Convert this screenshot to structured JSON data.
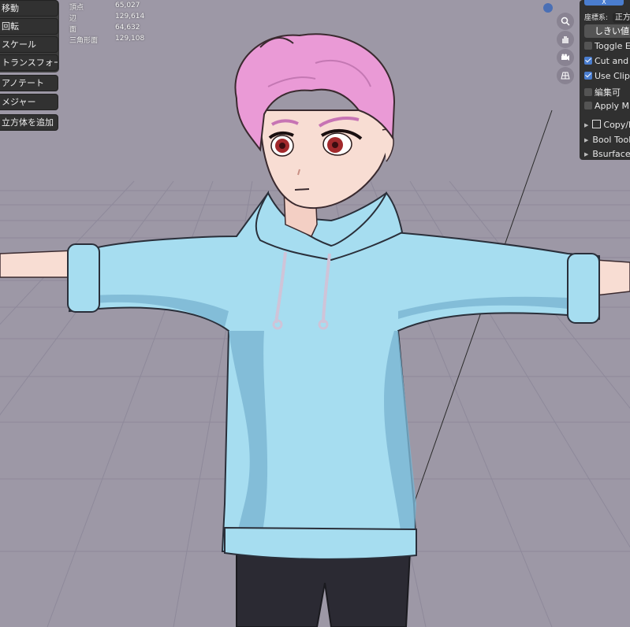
{
  "toolbar": {
    "move": "移動",
    "rotate": "回転",
    "scale": "スケール",
    "transform": "トランスフォーム",
    "annotate": "アノテート",
    "measure": "メジャー",
    "add_cube": "立方体を追加"
  },
  "stats": {
    "vertices_label": "頂点",
    "vertices": "65,027",
    "edges_label": "辺",
    "edges": "129,614",
    "faces_label": "面",
    "faces": "64,632",
    "triangles_label": "三角形面",
    "triangles": "129,108"
  },
  "sidebar": {
    "header_btn": "X",
    "coord_label": "座標系:",
    "coord_value": "正方",
    "threshold_btn": "しきい値",
    "toggle_edit": "Toggle Ed",
    "cut_and": "Cut and B",
    "use_clip": "Use Clip",
    "editable": "編集可",
    "apply_mi": "Apply Mi",
    "copy_r": "Copy/R",
    "bool_tool": "Bool Tool",
    "bsurfaces": "Bsurfaces"
  },
  "icons": [
    "zoom-icon",
    "hand-pan-icon",
    "camera-icon",
    "perspective-grid-icon"
  ],
  "colors": {
    "viewport_bg": "#9d98a6",
    "hair": "#ea9ad6",
    "hoodie": "#a6ddf0",
    "pants": "#2b2a33",
    "skin": "#f8ddd3",
    "checkbox_on": "#4a7dcf"
  }
}
